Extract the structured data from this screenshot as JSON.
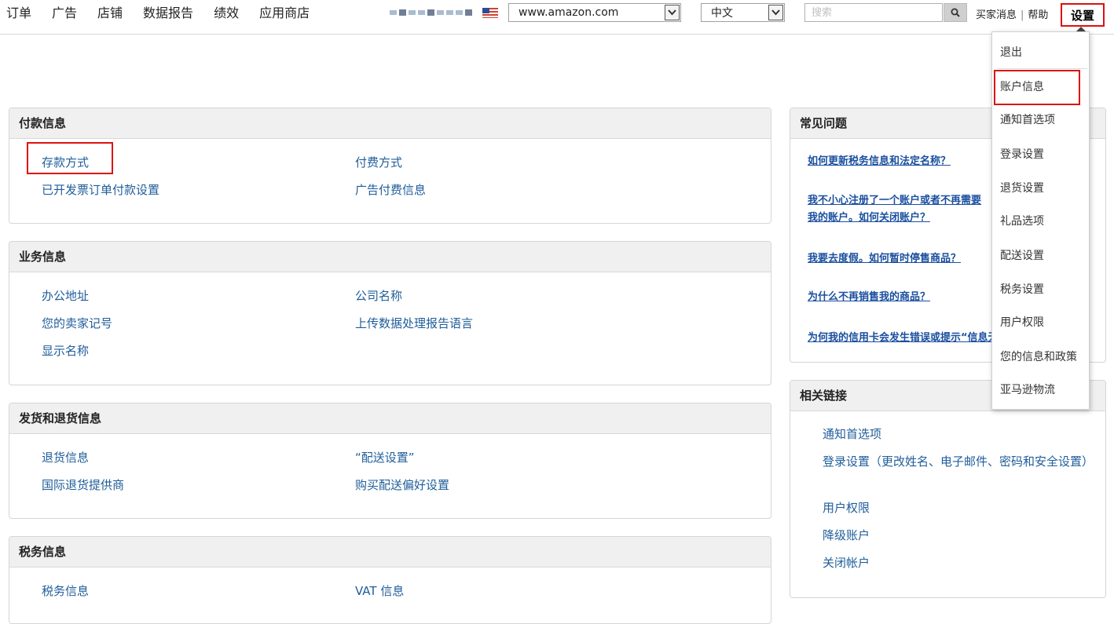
{
  "nav": [
    "订单",
    "广告",
    "店铺",
    "数据报告",
    "绩效",
    "应用商店"
  ],
  "marketplace": {
    "value": "www.amazon.com"
  },
  "language": {
    "value": "中文"
  },
  "search": {
    "placeholder": "搜索"
  },
  "toplinks": {
    "buyer_messages": "买家消息",
    "sep": "|",
    "help": "帮助",
    "settings": "设置"
  },
  "panels": {
    "payment": {
      "title": "付款信息",
      "links": [
        "存款方式",
        "付费方式",
        "已开发票订单付款设置",
        "广告付费信息"
      ]
    },
    "business": {
      "title": "业务信息",
      "links": [
        "办公地址",
        "公司名称",
        "您的卖家记号",
        "上传数据处理报告语言",
        "显示名称"
      ]
    },
    "shipping": {
      "title": "发货和退货信息",
      "links": [
        "退货信息",
        "“配送设置”",
        "国际退货提供商",
        "购买配送偏好设置"
      ]
    },
    "tax": {
      "title": "税务信息",
      "links": [
        "税务信息",
        "VAT 信息"
      ]
    }
  },
  "faq": {
    "title": "常见问题",
    "items": [
      "如何更新税务信息和法定名称？",
      "我不小心注册了一个账户或者不再需要我的账户。如何关闭账户？",
      "我要去度假。如何暂时停售商品？",
      "为什么不再销售我的商品？",
      "为何我的信用卡会发生错误或提示“信息无效”？"
    ]
  },
  "related": {
    "title": "相关链接",
    "items": [
      "通知首选项",
      "登录设置（更改姓名、电子邮件、密码和安全设置）",
      "用户权限",
      "降级账户",
      "关闭帐户"
    ]
  },
  "dropdown": [
    "退出",
    "账户信息",
    "通知首选项",
    "登录设置",
    "退货设置",
    "礼品选项",
    "配送设置",
    "税务设置",
    "用户权限",
    "您的信息和政策",
    "亚马逊物流"
  ],
  "colors": {
    "link": "#1f5d9a",
    "highlight": "#dd1111",
    "panel_header": "#f0f0f0"
  }
}
